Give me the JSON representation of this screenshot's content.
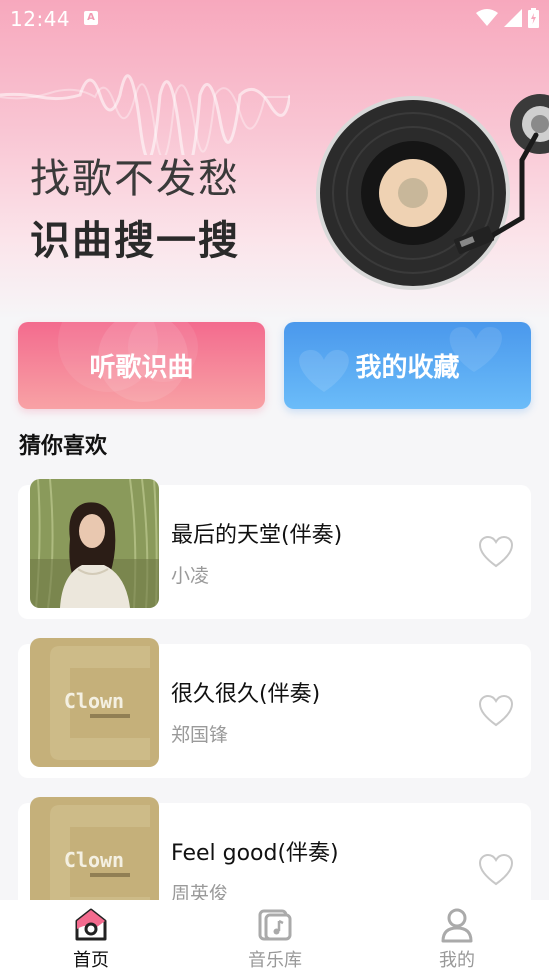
{
  "status_bar": {
    "time": "12:44",
    "notification_badge": "A"
  },
  "hero": {
    "title_line1": "找歌不发愁",
    "title_line2": "识曲搜一搜"
  },
  "actions": {
    "recognize_label": "听歌识曲",
    "favorites_label": "我的收藏"
  },
  "section": {
    "title": "猜你喜欢"
  },
  "songs": [
    {
      "title": "最后的天堂(伴奏)",
      "artist": "小凌",
      "cover": "photo"
    },
    {
      "title": "很久很久(伴奏)",
      "artist": "郑国锋",
      "cover": "clown-album",
      "cover_text": "Clown"
    },
    {
      "title": "Feel good(伴奏)",
      "artist": "周英俊",
      "cover": "clown-album",
      "cover_text": "Clown"
    }
  ],
  "tabs": [
    {
      "label": "首页",
      "icon": "home-icon",
      "active": true
    },
    {
      "label": "音乐库",
      "icon": "music-library-icon",
      "active": false
    },
    {
      "label": "我的",
      "icon": "profile-icon",
      "active": false
    }
  ],
  "colors": {
    "accent_pink": "#f36b8e",
    "accent_blue": "#4a98ec"
  }
}
